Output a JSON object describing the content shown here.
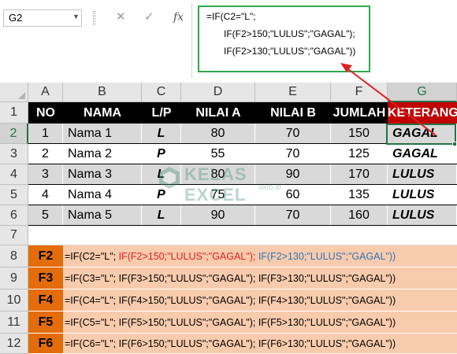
{
  "formula_bar": {
    "name_box": "G2",
    "cancel_icon": "✕",
    "enter_icon": "✓",
    "fx_label": "fx",
    "formula_lines": [
      "=IF(C2=\"L\";",
      "IF(F2>150;\"LULUS\";\"GAGAL\");",
      "IF(F2>130;\"LULUS\";\"GAGAL\"))"
    ]
  },
  "columns": [
    "A",
    "B",
    "C",
    "D",
    "E",
    "F",
    "G"
  ],
  "selected_column": "G",
  "rows": [
    "1",
    "2",
    "3",
    "4",
    "5",
    "6",
    "7",
    "8",
    "9",
    "10",
    "11",
    "12"
  ],
  "selected_row": "2",
  "table": {
    "headers": [
      "NO",
      "NAMA",
      "L/P",
      "NILAI A",
      "NILAI B",
      "JUMLAH",
      "KETERANGAN"
    ],
    "records": [
      {
        "no": "1",
        "nama": "Nama 1",
        "lp": "L",
        "nilai_a": "80",
        "nilai_b": "70",
        "jumlah": "150",
        "keterangan": "GAGAL"
      },
      {
        "no": "2",
        "nama": "Nama 2",
        "lp": "P",
        "nilai_a": "55",
        "nilai_b": "70",
        "jumlah": "125",
        "keterangan": "GAGAL"
      },
      {
        "no": "3",
        "nama": "Nama 3",
        "lp": "L",
        "nilai_a": "80",
        "nilai_b": "90",
        "jumlah": "170",
        "keterangan": "LULUS"
      },
      {
        "no": "4",
        "nama": "Nama 4",
        "lp": "P",
        "nilai_a": "75",
        "nilai_b": "60",
        "jumlah": "135",
        "keterangan": "LULUS"
      },
      {
        "no": "5",
        "nama": "Nama 5",
        "lp": "L",
        "nilai_a": "90",
        "nilai_b": "70",
        "jumlah": "160",
        "keterangan": "LULUS"
      }
    ]
  },
  "watermark": {
    "brand": "KELAS EXCEL",
    "domain": "web.id"
  },
  "formulas": [
    {
      "label": "F2",
      "part1": "=IF(C2=\"L\"; ",
      "part2": "IF(F2>150;\"LULUS\";\"GAGAL\");",
      "part3": " IF(F2>130;\"LULUS\";\"GAGAL\"))"
    },
    {
      "label": "F3",
      "part1": "=IF(C3=\"L\"; ",
      "part2": "IF(F3>150;\"LULUS\";\"GAGAL\");",
      "part3": " IF(F3>130;\"LULUS\";\"GAGAL\"))"
    },
    {
      "label": "F4",
      "part1": "=IF(C4=\"L\"; ",
      "part2": "IF(F4>150;\"LULUS\";\"GAGAL\");",
      "part3": " IF(F4>130;\"LULUS\";\"GAGAL\"))"
    },
    {
      "label": "F5",
      "part1": "=IF(C5=\"L\"; ",
      "part2": "IF(F5>150;\"LULUS\";\"GAGAL\");",
      "part3": " IF(F5>130;\"LULUS\";\"GAGAL\"))"
    },
    {
      "label": "F6",
      "part1": "=IF(C6=\"L\"; ",
      "part2": "IF(F6>150;\"LULUS\";\"GAGAL\");",
      "part3": " IF(F6>130;\"LULUS\";\"GAGAL\"))"
    }
  ],
  "colors": {
    "header_bg": "#000000",
    "keterangan_header_bg": "#c00000",
    "formula_box_border": "#2fa84f",
    "selection": "#217346",
    "formula_label_bg": "#e46c0a",
    "formula_text_bg": "#f8cbad",
    "highlight_red": "#e02020",
    "highlight_blue": "#2e75b6",
    "arrow": "#e02020"
  }
}
